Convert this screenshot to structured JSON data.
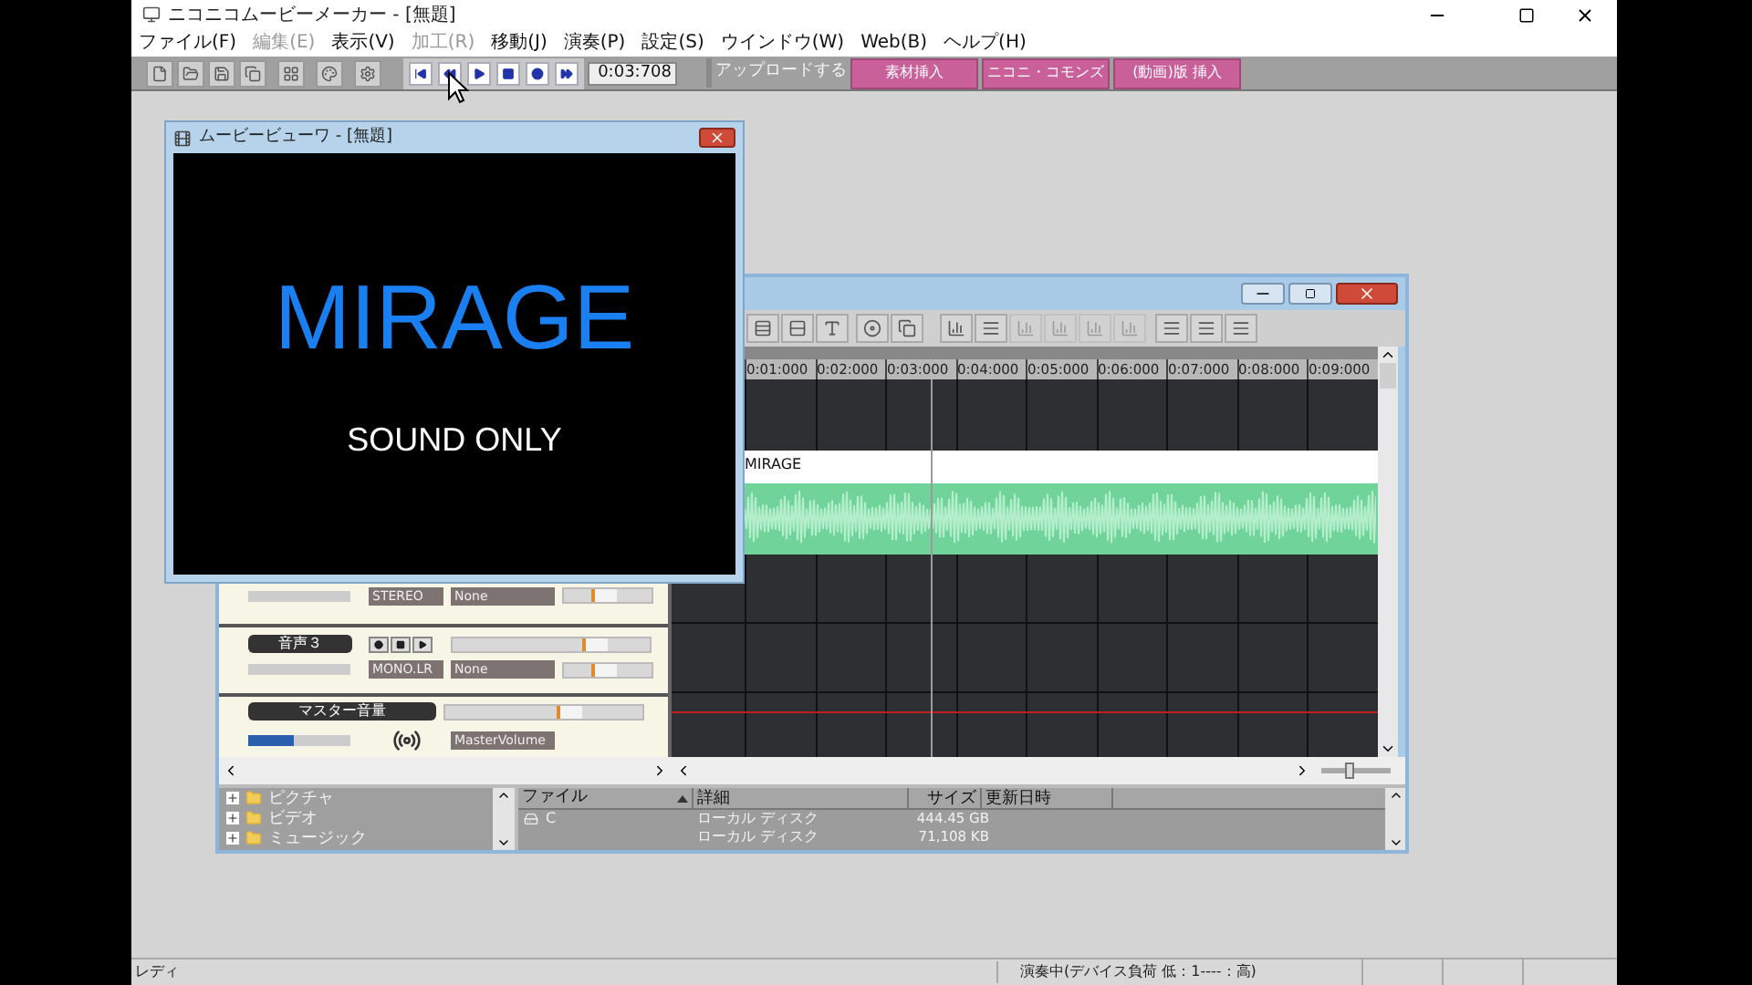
{
  "window": {
    "title": "ニコニコムービーメーカー - [無題]"
  },
  "menu": [
    {
      "label": "ファイル(F)",
      "disabled": false
    },
    {
      "label": "編集(E)",
      "disabled": true
    },
    {
      "label": "表示(V)",
      "disabled": false
    },
    {
      "label": "加工(R)",
      "disabled": true
    },
    {
      "label": "移動(J)",
      "disabled": false
    },
    {
      "label": "演奏(P)",
      "disabled": false
    },
    {
      "label": "設定(S)",
      "disabled": false
    },
    {
      "label": "ウインドウ(W)",
      "disabled": false
    },
    {
      "label": "Web(B)",
      "disabled": false
    },
    {
      "label": "ヘルプ(H)",
      "disabled": false
    }
  ],
  "toolbar": {
    "time": "0:03:708",
    "upload": {
      "label": "アップロードする",
      "disabled": true
    },
    "actions": [
      "素材挿入",
      "ニコニ・コモンズ",
      "(動画)版 挿入"
    ]
  },
  "viewer": {
    "title": "ムービービューワ - [無題]",
    "headline": "MIRAGE",
    "caption": "SOUND ONLY"
  },
  "timeline": {
    "ruler": [
      "0:01:000",
      "0:02:000",
      "0:03:000",
      "0:04:000",
      "0:05:000",
      "0:06:000",
      "0:07:000",
      "0:08:000",
      "0:09:000"
    ],
    "clip": "MIRAGE",
    "zoom": {
      "level": 0.4
    }
  },
  "tracks": [
    {
      "kind": "partial",
      "channel": "STEREO",
      "effect": "None",
      "pan": {
        "level": 0.45
      }
    },
    {
      "kind": "track",
      "name": "音声３",
      "channel": "MONO.LR",
      "effect": "None",
      "volume": {
        "level": 0.75
      },
      "pan": {
        "level": 0.45
      }
    },
    {
      "kind": "master",
      "name": "マスター音量",
      "label": "MasterVolume",
      "meter": {
        "level": 0.45
      },
      "volume": {
        "level": 0.65
      }
    }
  ],
  "browser": {
    "tree": [
      "ピクチャ",
      "ビデオ",
      "ミュージック"
    ],
    "columns": [
      "ファイル",
      "詳細",
      "サイズ",
      "更新日時"
    ],
    "rows": [
      {
        "name": "C",
        "detail": "ローカル ディスク",
        "size": "444.45 GB"
      },
      {
        "detail": "ローカル ディスク",
        "size": "71,108 KB"
      }
    ]
  },
  "status_bar": {
    "left": "レディ",
    "right": "演奏中(デバイス負荷 低：1----：高)"
  }
}
